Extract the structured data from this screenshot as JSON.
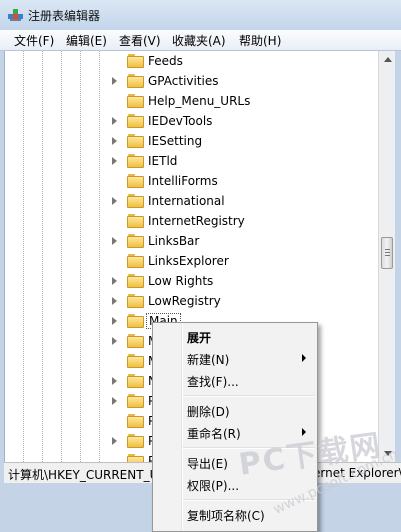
{
  "window": {
    "title": "注册表编辑器"
  },
  "menubar": {
    "items": [
      "文件(F)",
      "编辑(E)",
      "查看(V)",
      "收藏夹(A)",
      "帮助(H)"
    ]
  },
  "tree": {
    "items": [
      {
        "label": "Feeds",
        "expandable": false
      },
      {
        "label": "GPActivities",
        "expandable": true
      },
      {
        "label": "Help_Menu_URLs",
        "expandable": false
      },
      {
        "label": "IEDevTools",
        "expandable": true
      },
      {
        "label": "IESetting",
        "expandable": true
      },
      {
        "label": "IETld",
        "expandable": true
      },
      {
        "label": "IntelliForms",
        "expandable": false
      },
      {
        "label": "International",
        "expandable": true
      },
      {
        "label": "InternetRegistry",
        "expandable": false
      },
      {
        "label": "LinksBar",
        "expandable": true
      },
      {
        "label": "LinksExplorer",
        "expandable": false
      },
      {
        "label": "Low Rights",
        "expandable": true
      },
      {
        "label": "LowRegistry",
        "expandable": true
      },
      {
        "label": "Main",
        "expandable": true,
        "selected": true
      },
      {
        "label": "M",
        "expandable": true
      },
      {
        "label": "M",
        "expandable": false
      },
      {
        "label": "N",
        "expandable": true
      },
      {
        "label": "P",
        "expandable": true
      },
      {
        "label": "P",
        "expandable": false
      },
      {
        "label": "P",
        "expandable": true
      },
      {
        "label": "P",
        "expandable": false
      }
    ]
  },
  "statusbar": {
    "path_left": "计算机\\HKEY_CURRENT_U",
    "path_right": "ernet Explorer\\"
  },
  "context_menu": {
    "items": [
      {
        "label": "展开",
        "bold": true,
        "submenu": false
      },
      {
        "label": "新建(N)",
        "bold": false,
        "submenu": true
      },
      {
        "label": "查找(F)...",
        "bold": false,
        "submenu": false
      },
      {
        "label": "删除(D)",
        "bold": false,
        "submenu": false
      },
      {
        "label": "重命名(R)",
        "bold": false,
        "submenu": true
      },
      {
        "label": "导出(E)",
        "bold": false,
        "submenu": false
      },
      {
        "label": "权限(P)...",
        "bold": false,
        "submenu": false
      },
      {
        "label": "复制项名称(C)",
        "bold": false,
        "submenu": false
      }
    ]
  },
  "watermark": {
    "brand": "PC下载网",
    "url": "www.pcsoft.com.cn"
  }
}
